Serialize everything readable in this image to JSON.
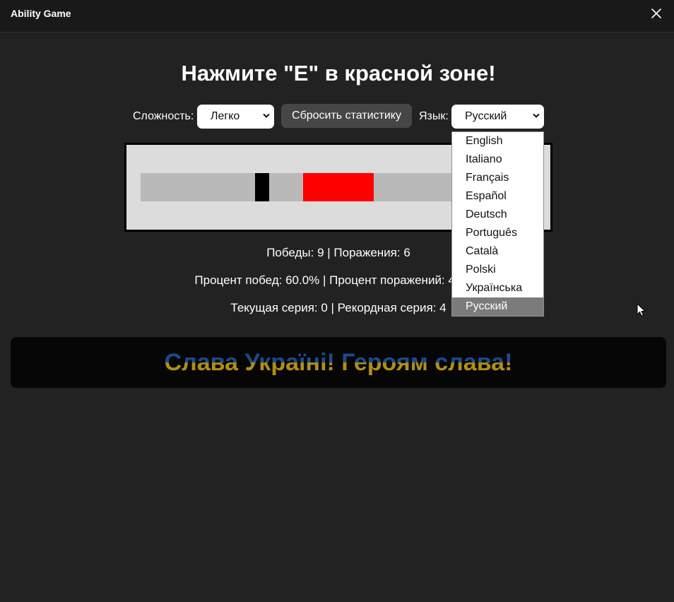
{
  "window": {
    "title": "Ability Game",
    "close_icon": "close-icon"
  },
  "heading": "Нажмите \"E\" в красной зоне!",
  "controls": {
    "difficulty_label": "Сложность:",
    "difficulty_value": "Легко",
    "reset_label": "Сбросить статистику",
    "language_label": "Язык:",
    "language_value": "Русский"
  },
  "language_options": [
    "English",
    "Italiano",
    "Français",
    "Español",
    "Deutsch",
    "Português",
    "Català",
    "Polski",
    "Українська",
    "Русский"
  ],
  "selected_language_index": 9,
  "stats": {
    "line1": "Победы: 9 | Поражения: 6",
    "line2": "Процент побед: 60.0% | Процент поражений: 40.0%",
    "line3": "Текущая серия: 0 | Рекордная серия: 4"
  },
  "banner": {
    "text": "Слава Україні! Героям слава!"
  },
  "colors": {
    "background": "#222222",
    "red_zone": "#ff0000",
    "banner_blue": "#1f5fb3",
    "banner_yellow": "#e2b714"
  }
}
